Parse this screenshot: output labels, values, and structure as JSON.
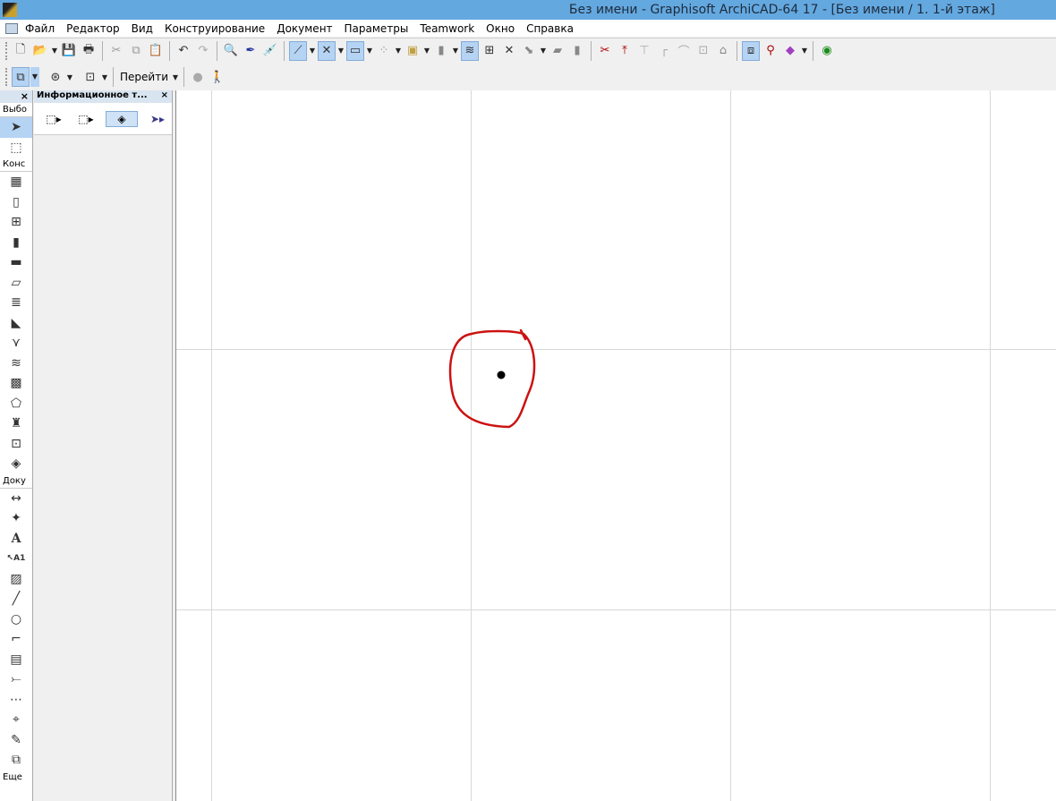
{
  "window": {
    "title": "Без имени - Graphisoft ArchiCAD-64 17 - [Без имени / 1. 1-й этаж]"
  },
  "menu": [
    "Файл",
    "Редактор",
    "Вид",
    "Конструирование",
    "Документ",
    "Параметры",
    "Teamwork",
    "Окно",
    "Справка"
  ],
  "toolbar2": {
    "goto_label": "Перейти"
  },
  "toolbox": {
    "close": "×",
    "groups": {
      "select": "Выбо",
      "construct": "Конс",
      "document": "Доку",
      "more": "Еще"
    }
  },
  "infobox": {
    "title": "Информационное т...",
    "close": "×"
  },
  "annotation": {
    "color": "#cc1111"
  }
}
